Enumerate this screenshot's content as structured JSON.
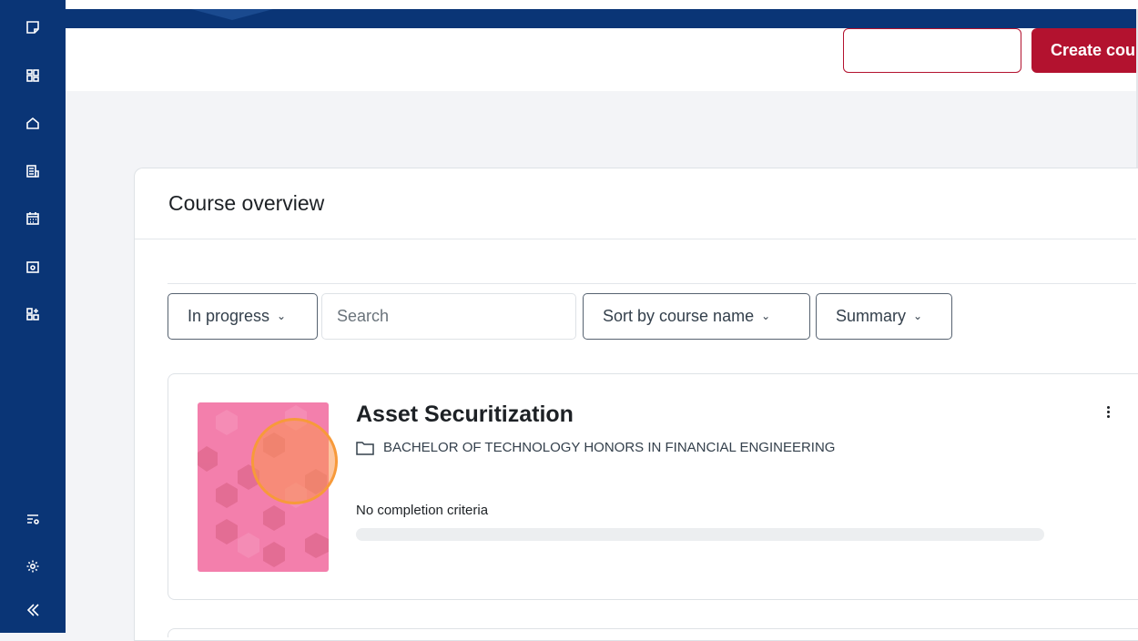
{
  "rail": {
    "icons": [
      "note-icon",
      "grid-icon",
      "home-icon",
      "report-icon",
      "calendar-icon",
      "folder-star-icon",
      "apps-icon",
      "list-settings-icon",
      "gear-icon",
      "collapse-icon"
    ]
  },
  "header": {
    "outline_button_label": "",
    "create_button_label": "Create cou"
  },
  "overview": {
    "title": "Course overview",
    "filters": {
      "status_label": "In progress",
      "search_placeholder": "Search",
      "sort_label": "Sort by course name",
      "view_label": "Summary"
    },
    "courses": [
      {
        "name": "Asset Securitization",
        "category": "BACHELOR OF TECHNOLOGY HONORS IN FINANCIAL ENGINEERING",
        "completion_text": "No completion criteria",
        "progress": 0
      }
    ]
  },
  "colors": {
    "rail": "#0a3576",
    "brand_red": "#b3122f",
    "thumb_pink": "#f37fac",
    "highlight": "#f79a3a"
  }
}
